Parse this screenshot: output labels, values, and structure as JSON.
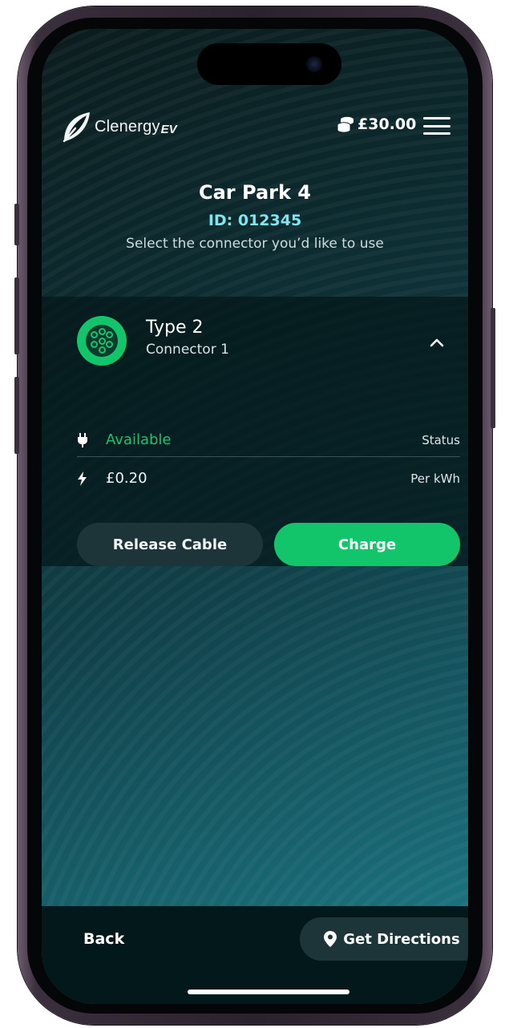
{
  "header": {
    "brand_name": "Clenergy",
    "brand_suffix": "EV",
    "balance": "£30.00",
    "icons": {
      "logo": "leaf-logo-icon",
      "balance": "coins-icon",
      "menu": "hamburger-menu-icon"
    }
  },
  "site": {
    "title": "Car Park 4",
    "id_label": "ID: 012345",
    "instruction": "Select the connector you’d like to use"
  },
  "connector": {
    "type": "Type 2",
    "name": "Connector 1",
    "status_value": "Available",
    "status_label": "Status",
    "price_value": "£0.20",
    "price_label": "Per kWh",
    "icons": {
      "connector": "type2-connector-icon",
      "collapse": "chevron-up-icon",
      "status": "plug-icon",
      "price": "lightning-bolt-icon"
    }
  },
  "actions": {
    "release_label": "Release Cable",
    "charge_label": "Charge"
  },
  "footer": {
    "back_label": "Back",
    "directions_label": "Get Directions",
    "icons": {
      "directions": "map-pin-icon"
    }
  },
  "colors": {
    "accent_green": "#13c56a",
    "id_cyan": "#7fe6ef",
    "background_dark": "#0c2a2e",
    "background_teal": "#1e7e8a",
    "button_dark": "#1d3538"
  }
}
